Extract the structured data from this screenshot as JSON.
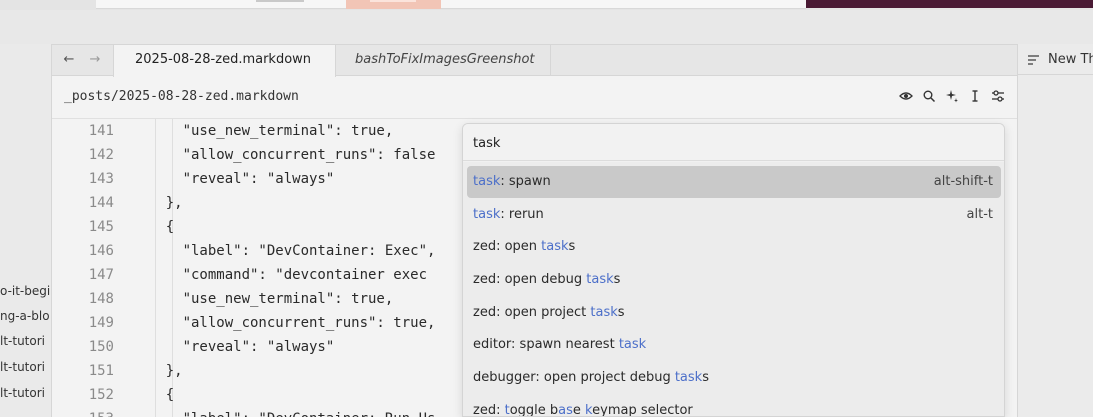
{
  "sidebar": {
    "items": [
      "o-it-begi",
      "ng-a-blo",
      "lt-tutori",
      "lt-tutori",
      "lt-tutori"
    ]
  },
  "tabs": {
    "active": "2025-08-28-zed.markdown",
    "inactive": "bashToFixImagesGreenshot"
  },
  "breadcrumb": "_posts/2025-08-28-zed.markdown",
  "right_panel": {
    "label": "New Th"
  },
  "code_lines": [
    {
      "n": "141",
      "t": "      \"use_new_terminal\": true,"
    },
    {
      "n": "142",
      "t": "      \"allow_concurrent_runs\": false"
    },
    {
      "n": "143",
      "t": "      \"reveal\": \"always\""
    },
    {
      "n": "144",
      "t": "    },"
    },
    {
      "n": "145",
      "t": "    {"
    },
    {
      "n": "146",
      "t": "      \"label\": \"DevContainer: Exec\","
    },
    {
      "n": "147",
      "t": "      \"command\": \"devcontainer exec"
    },
    {
      "n": "148",
      "t": "      \"use_new_terminal\": true,"
    },
    {
      "n": "149",
      "t": "      \"allow_concurrent_runs\": true,"
    },
    {
      "n": "150",
      "t": "      \"reveal\": \"always\""
    },
    {
      "n": "151",
      "t": "    },"
    },
    {
      "n": "152",
      "t": "    {"
    },
    {
      "n": "153",
      "t": "      \"label\": \"DevContainer: Run Us"
    }
  ],
  "palette": {
    "query": "task",
    "items": [
      {
        "parts": [
          [
            "task",
            true
          ],
          [
            ": spawn",
            false
          ]
        ],
        "key": "alt-shift-t",
        "selected": true
      },
      {
        "parts": [
          [
            "task",
            true
          ],
          [
            ": rerun",
            false
          ]
        ],
        "key": "alt-t",
        "selected": false
      },
      {
        "parts": [
          [
            "zed: open ",
            false
          ],
          [
            "task",
            true
          ],
          [
            "s",
            false
          ]
        ],
        "key": "",
        "selected": false
      },
      {
        "parts": [
          [
            "zed: open debug ",
            false
          ],
          [
            "task",
            true
          ],
          [
            "s",
            false
          ]
        ],
        "key": "",
        "selected": false
      },
      {
        "parts": [
          [
            "zed: open project ",
            false
          ],
          [
            "task",
            true
          ],
          [
            "s",
            false
          ]
        ],
        "key": "",
        "selected": false
      },
      {
        "parts": [
          [
            "editor: spawn nearest ",
            false
          ],
          [
            "task",
            true
          ]
        ],
        "key": "",
        "selected": false
      },
      {
        "parts": [
          [
            "debugger: open project debug ",
            false
          ],
          [
            "task",
            true
          ],
          [
            "s",
            false
          ]
        ],
        "key": "",
        "selected": false
      },
      {
        "parts": [
          [
            "zed: ",
            false
          ],
          [
            "t",
            true
          ],
          [
            "oggle b",
            false
          ],
          [
            "as",
            true
          ],
          [
            "e ",
            false
          ],
          [
            "k",
            true
          ],
          [
            "eymap selector",
            false
          ]
        ],
        "key": "",
        "selected": false
      }
    ]
  },
  "icons": [
    "back-arrow-icon",
    "forward-arrow-icon",
    "eye-icon",
    "search-icon",
    "sparkle-icon",
    "text-cursor-icon",
    "settings-sliders-icon",
    "outline-list-icon"
  ]
}
